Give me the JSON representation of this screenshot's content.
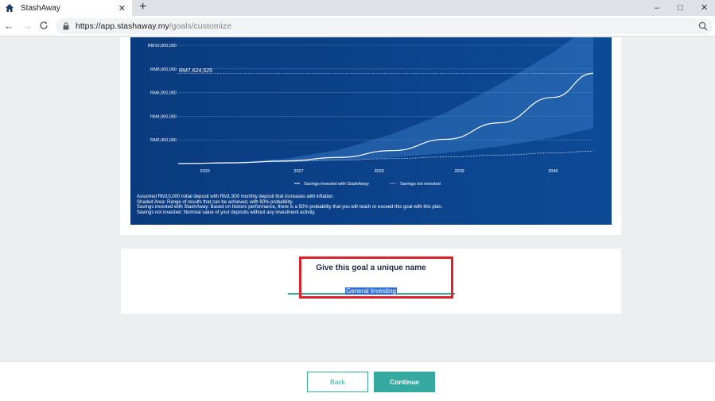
{
  "browser": {
    "tab_title": "StashAway",
    "tab_close": "✕",
    "new_tab": "+",
    "url_host": "https://app.stashaway.my",
    "url_path": "/goals/customize",
    "window_controls": {
      "minimize": "–",
      "maximize": "□",
      "close": "✕"
    }
  },
  "chart_data": {
    "type": "area",
    "y_tick_labels": [
      "RM10,000,000",
      "RM8,000,000",
      "RM6,000,000",
      "RM4,000,000",
      "RM2,000,000"
    ],
    "x_tick_labels": [
      "2020",
      "2027",
      "2033",
      "2039",
      "2046"
    ],
    "ylim": [
      0,
      10000000
    ],
    "target_label": "RM7,624,525",
    "target_value": 7624525,
    "series": [
      {
        "name": "Savings invested with StashAway",
        "x": [
          2018,
          2022,
          2026,
          2030,
          2034,
          2038,
          2042,
          2046,
          2049
        ],
        "values": [
          0,
          60000,
          220000,
          520000,
          1100000,
          2050000,
          3450000,
          5600000,
          7624525
        ]
      },
      {
        "name": "Savings not invested",
        "x": [
          2018,
          2022,
          2026,
          2030,
          2034,
          2038,
          2042,
          2046,
          2049
        ],
        "values": [
          0,
          85000,
          190000,
          300000,
          420000,
          560000,
          720000,
          900000,
          1050000
        ]
      }
    ],
    "band_upper": [
      0,
      100000,
      420000,
      1150000,
      2500000,
      4300000,
      6700000,
      9400000,
      11800000
    ],
    "band_lower": [
      0,
      35000,
      120000,
      270000,
      520000,
      900000,
      1450000,
      2200000,
      3000000
    ],
    "legend": [
      "Savings invested with StashAway",
      "Savings not invested"
    ],
    "legend_position": "bottom-center",
    "grid": true,
    "colors": {
      "background": "#0b3f86",
      "line": "#ffffff",
      "band": "#3c7fc9"
    }
  },
  "footnotes": [
    "Assumed RM10,000 initial deposit with RM1,900 monthly deposit that increases with inflation.",
    "Shaded Area: Range of results that can be achieved, with 90% probability.",
    "Savings invested with StashAway: Based on historic performance, there is a 50% probability that you will reach or exceed this goal with this plan.",
    "Savings not invested: Nominal value of your deposits without any investment activity."
  ],
  "goal_name": {
    "label": "Give this goal a unique name",
    "value": "General Investing"
  },
  "footer": {
    "back_label": "Back",
    "continue_label": "Continue"
  },
  "colors": {
    "accent": "#36a9a1",
    "highlight": "#e0202a",
    "selection": "#2d6fd6"
  }
}
